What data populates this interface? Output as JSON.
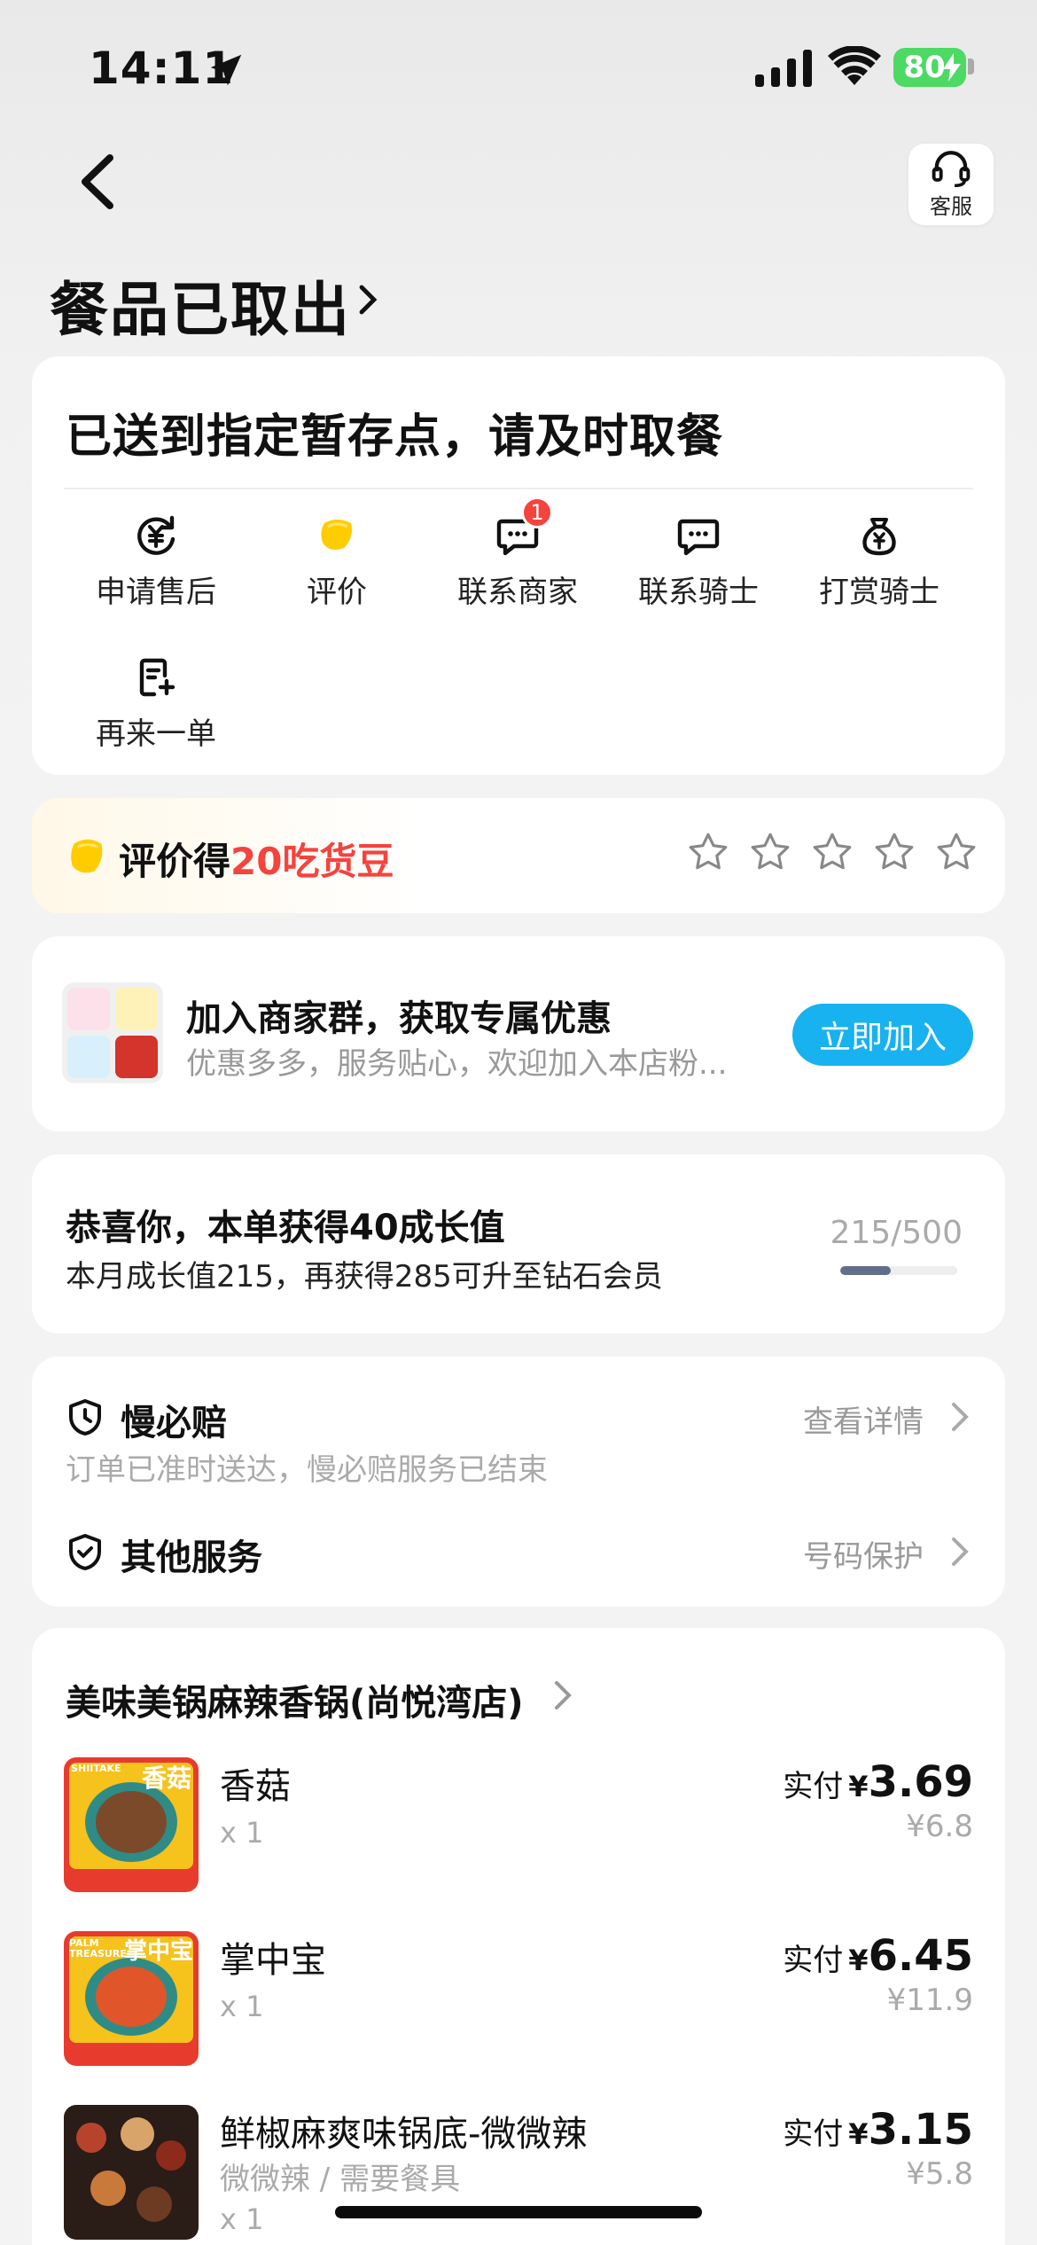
{
  "status_bar": {
    "time": "14:11",
    "battery": "80"
  },
  "header": {
    "service_label": "客服",
    "title": "餐品已取出"
  },
  "status_card": {
    "message": "已送到指定暂存点，请及时取餐",
    "actions": [
      {
        "label": "申请售后",
        "icon": "yuan-refresh-icon"
      },
      {
        "label": "评价",
        "icon": "bean-icon"
      },
      {
        "label": "联系商家",
        "icon": "chat-icon",
        "badge": "1"
      },
      {
        "label": "联系骑士",
        "icon": "chat-icon"
      },
      {
        "label": "打赏骑士",
        "icon": "money-bag-icon"
      },
      {
        "label": "再来一单",
        "icon": "reorder-icon"
      }
    ]
  },
  "rating": {
    "prefix": "评价得",
    "highlight": "20吃货豆",
    "stars": 5,
    "filled": 0
  },
  "group": {
    "title": "加入商家群，获取专属优惠",
    "subtitle": "优惠多多，服务贴心，欢迎加入本店粉...",
    "join_label": "立即加入"
  },
  "growth": {
    "title": "恭喜你，本单获得40成长值",
    "subtitle": "本月成长值215，再获得285可升至钻石会员",
    "count": "215/500",
    "progress": 0.43
  },
  "services": {
    "slow_pay": {
      "name": "慢必赔",
      "link": "查看详情",
      "note": "订单已准时送达，慢必赔服务已结束"
    },
    "other": {
      "name": "其他服务",
      "link": "号码保护"
    }
  },
  "order": {
    "shop_name": "美味美锅麻辣香锅(尚悦湾店)",
    "pay_label": "实付",
    "currency": "¥",
    "items": [
      {
        "name": "香菇",
        "qty": "x 1",
        "paid": "3.69",
        "original": "¥6.8",
        "thumb_en": "SHIITAKE",
        "thumb_cn": "香菇"
      },
      {
        "name": "掌中宝",
        "qty": "x 1",
        "paid": "6.45",
        "original": "¥11.9",
        "thumb_en": "PALM TREASURE",
        "thumb_cn": "掌中宝"
      },
      {
        "name": "鲜椒麻爽味锅底-微微辣",
        "spec": "微微辣 / 需要餐具",
        "qty": "x 1",
        "paid": "3.15",
        "original": "¥5.8"
      }
    ]
  },
  "colors": {
    "accent_blue": "#17b2ef",
    "highlight_red": "#f5433d",
    "battery_green": "#4cd964"
  }
}
